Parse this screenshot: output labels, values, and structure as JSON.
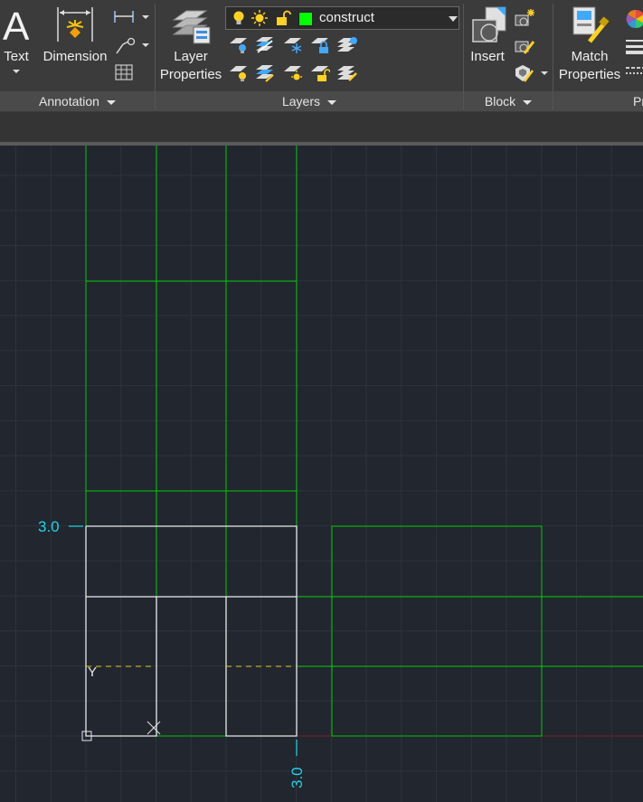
{
  "ribbon": {
    "annotation": {
      "text_label": "Text",
      "dimension_label": "Dimension",
      "panel_title": "Annotation"
    },
    "layers": {
      "layer_properties_line1": "Layer",
      "layer_properties_line2": "Properties",
      "current_layer": "construct",
      "current_layer_color": "#00ff00",
      "panel_title": "Layers"
    },
    "block": {
      "insert_label": "Insert",
      "panel_title": "Block"
    },
    "properties": {
      "match_line1": "Match",
      "match_line2": "Properties",
      "panel_title_partial": "Pr"
    }
  },
  "canvas": {
    "dimension_left": "3.0",
    "dimension_bottom": "3.0",
    "ucs_y": "Y",
    "colors": {
      "background": "#21262f",
      "grid": "#2d333d",
      "construct": "#00c800",
      "white": "#e8e8e8",
      "dimension": "#22d3e8",
      "hidden": "#d8c820",
      "axis": "#7a2020"
    }
  }
}
